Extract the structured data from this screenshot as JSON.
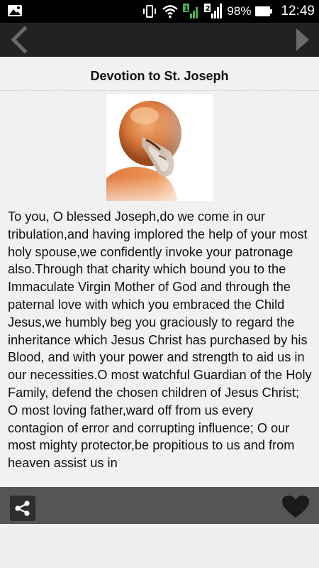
{
  "status_bar": {
    "battery": "98%",
    "time": "12:49",
    "sim1": "1",
    "sim2": "2",
    "icons": [
      "image-notification-icon",
      "vibrate-icon",
      "wifi-icon",
      "signal-1-icon",
      "signal-2-icon",
      "battery-icon"
    ]
  },
  "nav": {
    "back_icon": "chevron-left-icon",
    "next_icon": "play-right-icon"
  },
  "page": {
    "title": "Devotion to St. Joseph",
    "body": "To you, O blessed Joseph,do we come in our tribulation,and having implored the help of your most holy spouse,we confidently invoke your patronage also.Through that charity which bound you to the Immaculate Virgin Mother of God and through the paternal love with which you embraced the Child Jesus,we humbly beg you graciously to regard the inheritance which Jesus Christ has purchased by his Blood, and with your power and strength to aid us in our necessities.O most watchful Guardian of the Holy Family, defend the chosen children of Jesus Christ; O most loving father,ward off from us every contagion of error and corrupting influence; O our most mighty protector,be propitious to us and from heaven assist us in"
  },
  "bottom_bar": {
    "share_icon": "share-icon",
    "favorite_icon": "heart-icon"
  },
  "colors": {
    "status_bar_bg": "#000000",
    "nav_bg": "#222222",
    "content_bg": "#f1f1f1",
    "bottom_bar_bg": "#555555",
    "sim_green": "#4caf50"
  }
}
